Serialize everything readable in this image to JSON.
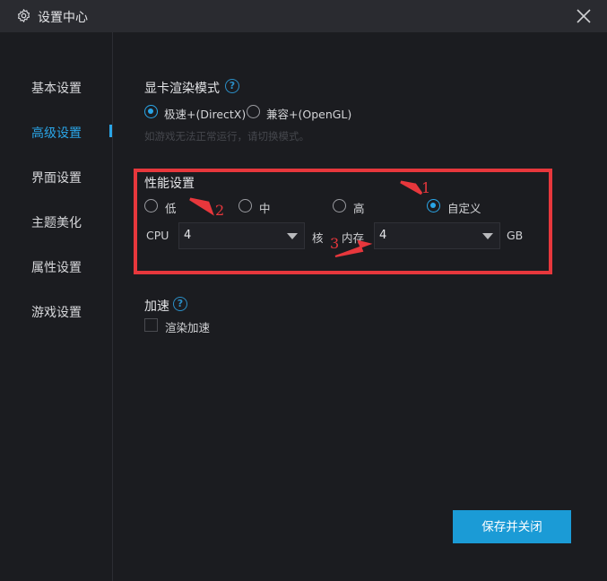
{
  "window": {
    "title": "设置中心",
    "icons": {
      "settings": "gear-icon",
      "close": "close-icon"
    }
  },
  "sidebar": {
    "items": [
      {
        "label": "基本设置",
        "active": false
      },
      {
        "label": "高级设置",
        "active": true
      },
      {
        "label": "界面设置",
        "active": false
      },
      {
        "label": "主题美化",
        "active": false
      },
      {
        "label": "属性设置",
        "active": false
      },
      {
        "label": "游戏设置",
        "active": false
      }
    ]
  },
  "render": {
    "title": "显卡渲染模式",
    "help_icon": "question-circle-icon",
    "options": [
      {
        "label": "极速+(DirectX)",
        "selected": true
      },
      {
        "label": "兼容+(OpenGL)",
        "selected": false
      }
    ],
    "hint": "如游戏无法正常运行，请切换模式。"
  },
  "performance": {
    "title": "性能设置",
    "options": [
      {
        "label": "低",
        "selected": false
      },
      {
        "label": "中",
        "selected": false
      },
      {
        "label": "高",
        "selected": false
      },
      {
        "label": "自定义",
        "selected": true
      }
    ],
    "cpu_label": "CPU",
    "cpu_value": "4",
    "cpu_unit": "核",
    "memory_label": "内存",
    "memory_value": "4",
    "memory_unit": "GB"
  },
  "annotations": [
    "1",
    "2",
    "3"
  ],
  "acceleration": {
    "title": "加速",
    "help_icon": "question-circle-icon",
    "checkbox_label": "渲染加速",
    "checked": false
  },
  "footer": {
    "save_label": "保存并关闭"
  },
  "colors": {
    "accent": "#2aa5e7",
    "annotation": "#e7373c",
    "button": "#1b9bd6",
    "background": "#1b1c20",
    "titlebar": "#2a2b30"
  }
}
